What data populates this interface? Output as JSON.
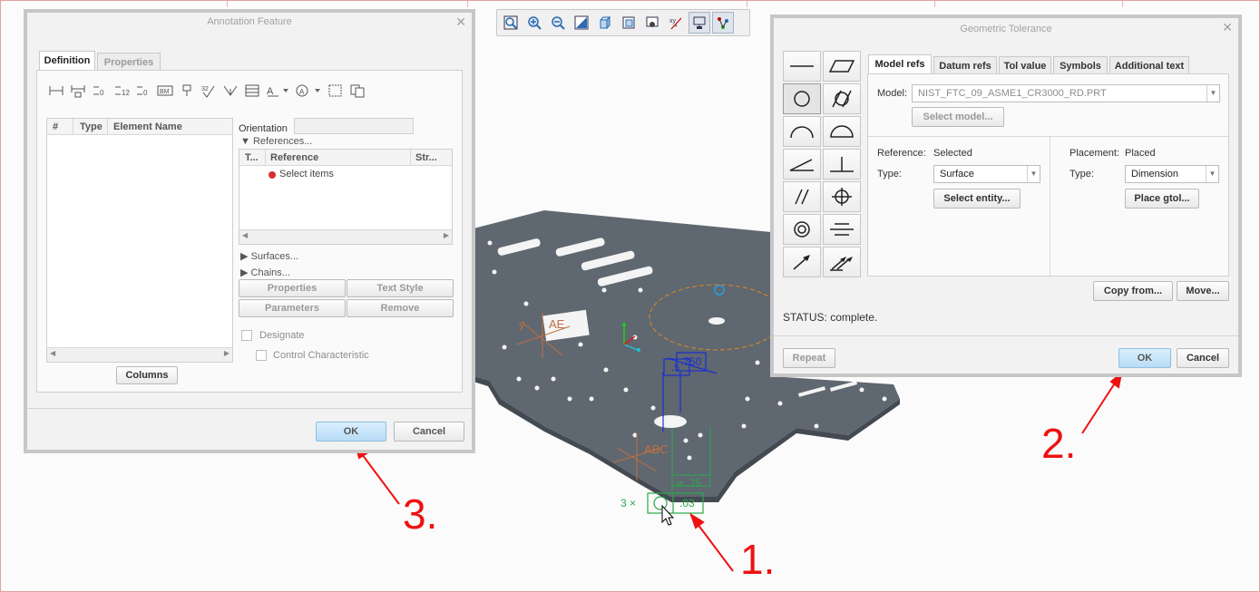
{
  "annotation_dialog": {
    "title": "Annotation Feature",
    "tabs": [
      "Definition",
      "Properties"
    ],
    "columns": [
      "#",
      "Type",
      "Element Name"
    ],
    "orientation_label": "Orientation",
    "references_label": "References...",
    "ref_columns": [
      "T...",
      "Reference",
      "Str..."
    ],
    "select_items": "Select items",
    "surfaces_label": "Surfaces...",
    "chains_label": "Chains...",
    "properties_btn": "Properties",
    "text_style_btn": "Text Style",
    "parameters_btn": "Parameters",
    "remove_btn": "Remove",
    "designate_label": "Designate",
    "control_characteristic_label": "Control Characteristic",
    "columns_btn": "Columns",
    "ok": "OK",
    "cancel": "Cancel"
  },
  "gtol_dialog": {
    "title": "Geometric Tolerance",
    "tabs": [
      "Model refs",
      "Datum refs",
      "Tol value",
      "Symbols",
      "Additional text"
    ],
    "model_label": "Model:",
    "model_value": "NIST_FTC_09_ASME1_CR3000_RD.PRT",
    "select_model_btn": "Select model...",
    "reference_label": "Reference:",
    "reference_value": "Selected",
    "ref_type_label": "Type:",
    "ref_type_value": "Surface",
    "select_entity_btn": "Select entity...",
    "placement_label": "Placement:",
    "placement_value": "Placed",
    "place_type_label": "Type:",
    "place_type_value": "Dimension",
    "place_gtol_btn": "Place gtol...",
    "copy_from_btn": "Copy from...",
    "move_btn": "Move...",
    "status": "STATUS: complete.",
    "repeat_btn": "Repeat",
    "ok": "OK",
    "cancel": "Cancel"
  },
  "callouts": {
    "one": "1.",
    "two": "2.",
    "three": "3."
  },
  "model_annotations": {
    "count": "3 ×",
    "tolerance": ".03",
    "diameter_value": "⌀ .75",
    "datum_label": "ABC",
    "datum_label_2": "AE",
    "axis_label": "y",
    "blue_value": ".750",
    "blue_value_2": ".5"
  },
  "colors": {
    "callout": "#ee1111",
    "gtol_green": "#2aa84a",
    "blue_dim": "#1b2fcf",
    "plate": "#5f6770"
  }
}
